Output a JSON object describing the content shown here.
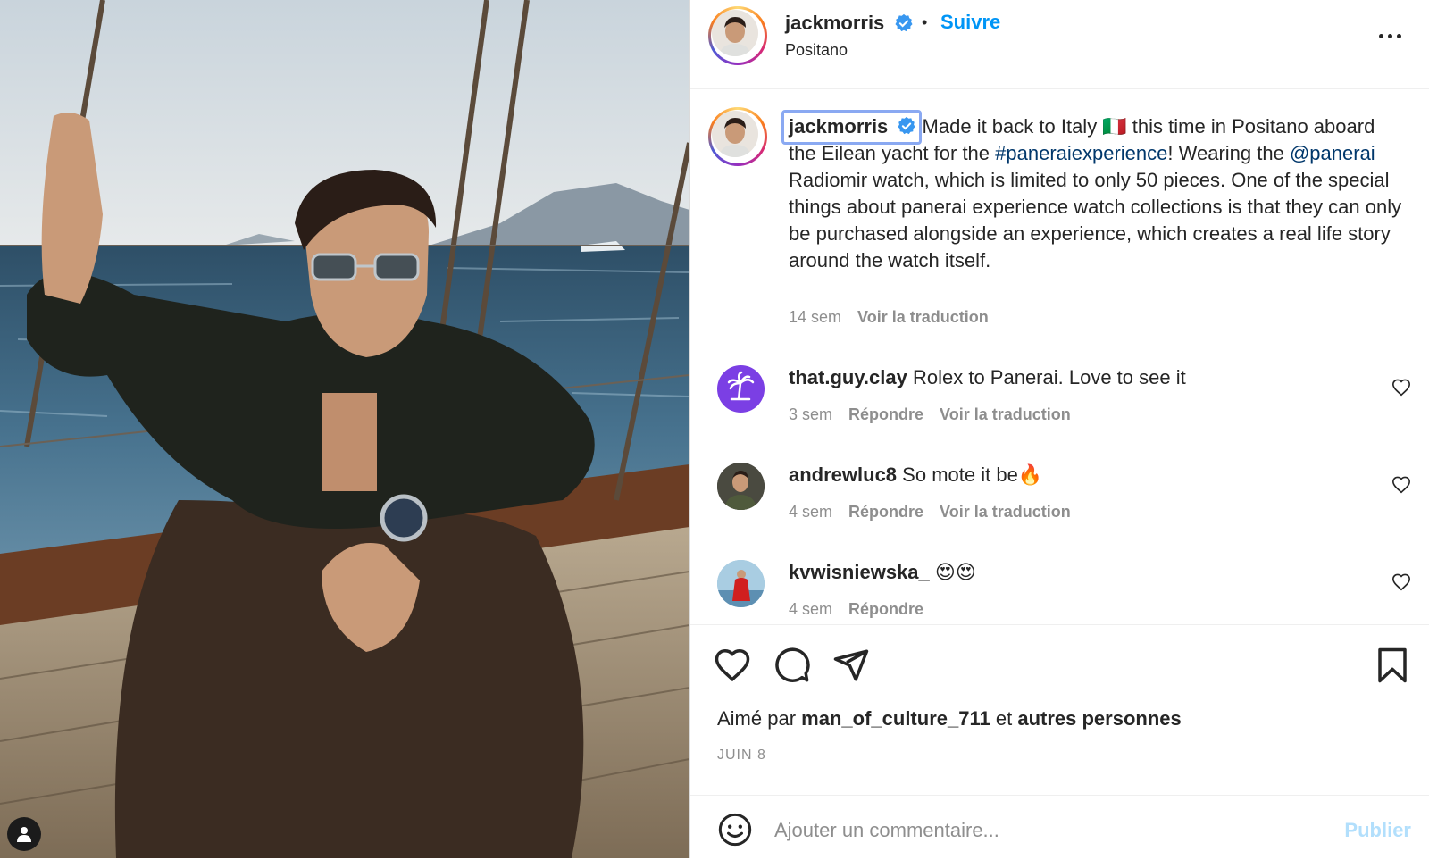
{
  "post": {
    "author": "jackmorris",
    "follow_label": "Suivre",
    "separator": "•",
    "location": "Positano",
    "caption": {
      "username": "jackmorris",
      "text_1": "Made it back to Italy 🇮🇹 this time in Positano aboard the Eilean yacht for the ",
      "hashtag": "#paneraiexperience",
      "text_2": "! Wearing the ",
      "mention": "@panerai",
      "text_3": " Radiomir watch, which is limited to only 50 pieces. One of the special things about panerai experience watch collections is that they can only be purchased alongside an experience, which creates a real life story around the watch itself.",
      "age": "14 sem",
      "translate": "Voir la traduction"
    },
    "comments": [
      {
        "username": "that.guy.clay",
        "text": "Rolex to Panerai. Love to see it",
        "age": "3 sem",
        "reply": "Répondre",
        "translate": "Voir la traduction"
      },
      {
        "username": "andrewluc8",
        "text": "So mote it be🔥",
        "age": "4 sem",
        "reply": "Répondre",
        "translate": "Voir la traduction"
      },
      {
        "username": "kvwisniewska_",
        "text": "😍😍",
        "age": "4 sem",
        "reply": "Répondre"
      }
    ],
    "likes": {
      "prefix": "Aimé par",
      "user": "man_of_culture_711",
      "middle": "et",
      "others": "autres personnes"
    },
    "date": "JUIN 8",
    "add_comment_placeholder": "Ajouter un commentaire...",
    "publish_label": "Publier"
  },
  "colors": {
    "accent": "#0095f6",
    "text": "#262626",
    "muted": "#8e8e8e",
    "hashtag": "#00376b",
    "publish_disabled": "#b2dffc"
  },
  "icons": [
    "user-tag-icon",
    "verified-badge-icon",
    "more-options-icon",
    "heart-icon",
    "comment-icon",
    "share-icon",
    "bookmark-icon",
    "emoji-icon"
  ]
}
